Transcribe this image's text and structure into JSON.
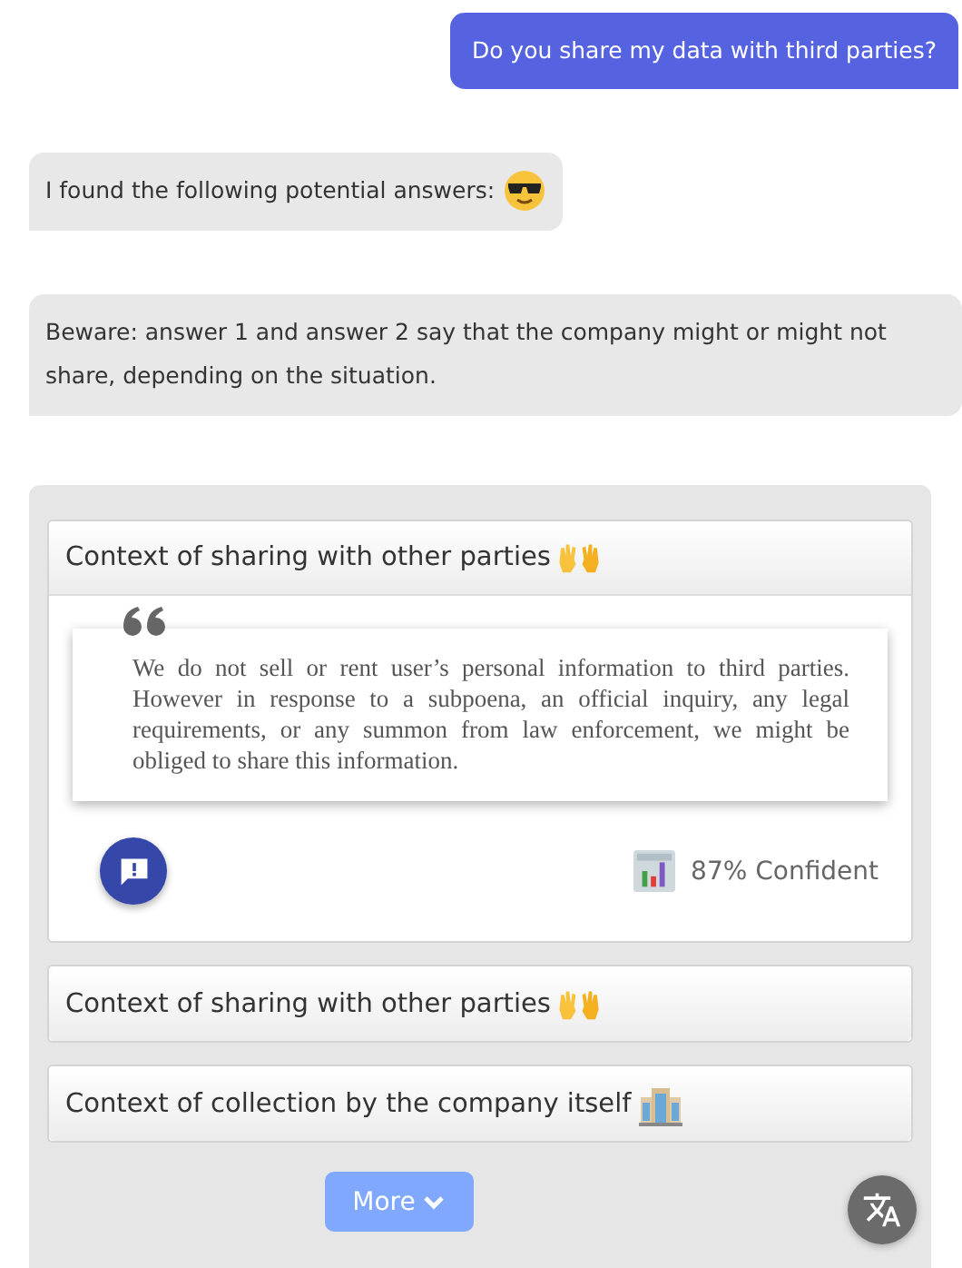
{
  "messages": [
    {
      "kind": "user",
      "text": "Do you share my data with third parties?"
    },
    {
      "kind": "bot",
      "text": "I found the following potential answers:"
    },
    {
      "kind": "bot",
      "text": "Beware: answer 1 and answer 2 say that the company might or might not share, depending on the situation."
    }
  ],
  "answers": [
    {
      "title": "Context of sharing with other parties",
      "expanded": true,
      "quote": "We do not sell or rent user’s personal information to third parties. However in response to a subpoena, an official inquiry, any legal requirements, or any summon from law enforcement, we might be obliged to share this information.",
      "confidence": "87% Confident"
    },
    {
      "title": "Context of sharing with other parties",
      "expanded": false
    },
    {
      "title": "Context of collection by the company itself",
      "expanded": false
    }
  ],
  "more_button": "More"
}
